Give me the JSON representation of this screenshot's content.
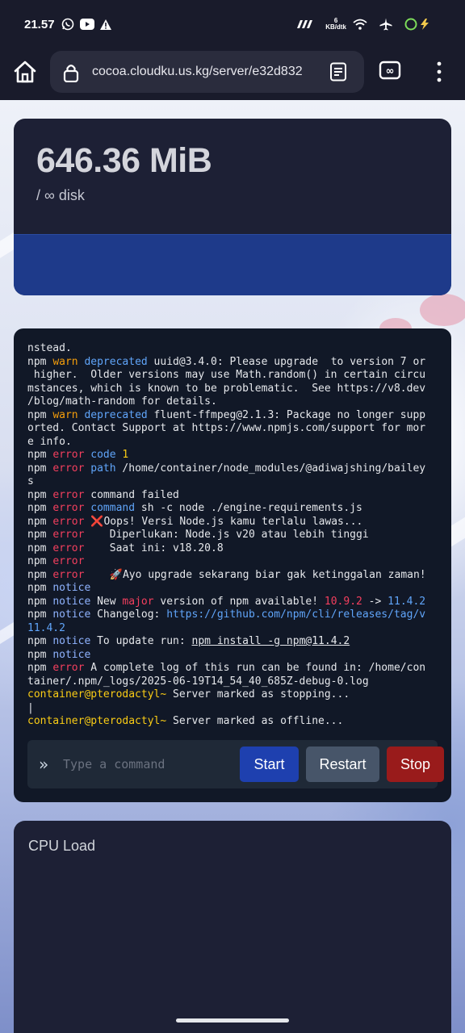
{
  "status_bar": {
    "time": "21.57",
    "net_speed_value": "6",
    "net_speed_unit": "KB/dtk",
    "icons": [
      "whatsapp-icon",
      "youtube-icon",
      "warning-icon",
      "signal-icon",
      "wifi-icon",
      "airplane-icon",
      "battery-icon"
    ]
  },
  "browser": {
    "url": "cocoa.cloudku.us.kg/server/e32d832",
    "icons": [
      "home-icon",
      "lock-icon",
      "reader-mode-icon",
      "tabs-icon",
      "more-vert-icon"
    ]
  },
  "disk": {
    "value": "646.36 MiB",
    "limit": "/ ∞ disk"
  },
  "console": {
    "lines": [
      [
        {
          "t": "nstead."
        }
      ],
      [
        {
          "t": "npm "
        },
        {
          "t": "warn",
          "c": "c-warn"
        },
        {
          "t": " "
        },
        {
          "t": "deprecated",
          "c": "c-blue"
        },
        {
          "t": " uuid@3.4.0: Please upgrade  to version 7 or"
        }
      ],
      [
        {
          "t": " higher.  Older versions may use Math.random() in certain circu"
        }
      ],
      [
        {
          "t": "mstances, which is known to be problematic.  See https://v8.dev"
        }
      ],
      [
        {
          "t": "/blog/math-random for details."
        }
      ],
      [
        {
          "t": "npm "
        },
        {
          "t": "warn",
          "c": "c-warn"
        },
        {
          "t": " "
        },
        {
          "t": "deprecated",
          "c": "c-blue"
        },
        {
          "t": " fluent-ffmpeg@2.1.3: Package no longer supp"
        }
      ],
      [
        {
          "t": "orted. Contact Support at https://www.npmjs.com/support for mor"
        }
      ],
      [
        {
          "t": "e info."
        }
      ],
      [
        {
          "t": "npm "
        },
        {
          "t": "error",
          "c": "c-err"
        },
        {
          "t": " "
        },
        {
          "t": "code",
          "c": "c-blue"
        },
        {
          "t": " "
        },
        {
          "t": "1",
          "c": "c-yellow"
        }
      ],
      [
        {
          "t": "npm "
        },
        {
          "t": "error",
          "c": "c-err"
        },
        {
          "t": " "
        },
        {
          "t": "path",
          "c": "c-blue"
        },
        {
          "t": " /home/container/node_modules/@adiwajshing/bailey"
        }
      ],
      [
        {
          "t": "s"
        }
      ],
      [
        {
          "t": "npm "
        },
        {
          "t": "error",
          "c": "c-err"
        },
        {
          "t": " command failed"
        }
      ],
      [
        {
          "t": "npm "
        },
        {
          "t": "error",
          "c": "c-err"
        },
        {
          "t": " "
        },
        {
          "t": "command",
          "c": "c-blue"
        },
        {
          "t": " sh -c node ./engine-requirements.js"
        }
      ],
      [
        {
          "t": "npm "
        },
        {
          "t": "error",
          "c": "c-err"
        },
        {
          "t": " "
        },
        {
          "t": "❌",
          "c": "c-err"
        },
        {
          "t": "Oops! Versi Node.js kamu terlalu lawas..."
        }
      ],
      [
        {
          "t": "npm "
        },
        {
          "t": "error",
          "c": "c-err"
        },
        {
          "t": "    Diperlukan: Node.js v20 atau lebih tinggi"
        }
      ],
      [
        {
          "t": "npm "
        },
        {
          "t": "error",
          "c": "c-err"
        },
        {
          "t": "    Saat ini: v18.20.8"
        }
      ],
      [
        {
          "t": "npm "
        },
        {
          "t": "error",
          "c": "c-err"
        }
      ],
      [
        {
          "t": "npm "
        },
        {
          "t": "error",
          "c": "c-err"
        },
        {
          "t": "    🚀Ayo upgrade sekarang biar gak ketinggalan zaman!"
        }
      ],
      [
        {
          "t": "npm "
        },
        {
          "t": "notice",
          "c": "c-notice"
        }
      ],
      [
        {
          "t": "npm "
        },
        {
          "t": "notice",
          "c": "c-notice"
        },
        {
          "t": " New "
        },
        {
          "t": "major",
          "c": "c-err"
        },
        {
          "t": " version of npm available! "
        },
        {
          "t": "10.9.2",
          "c": "c-err"
        },
        {
          "t": " -> "
        },
        {
          "t": "11.4.2",
          "c": "c-link"
        }
      ],
      [
        {
          "t": "npm "
        },
        {
          "t": "notice",
          "c": "c-notice"
        },
        {
          "t": " Changelog: "
        },
        {
          "t": "https://github.com/npm/cli/releases/tag/v",
          "c": "c-link"
        }
      ],
      [
        {
          "t": "11.4.2",
          "c": "c-link"
        }
      ],
      [
        {
          "t": "npm "
        },
        {
          "t": "notice",
          "c": "c-notice"
        },
        {
          "t": " To update run: "
        },
        {
          "t": "npm install -g npm@11.4.2",
          "c": "c-under"
        }
      ],
      [
        {
          "t": "npm "
        },
        {
          "t": "notice",
          "c": "c-notice"
        }
      ],
      [
        {
          "t": "npm "
        },
        {
          "t": "error",
          "c": "c-err"
        },
        {
          "t": " A complete log of this run can be found in: /home/con"
        }
      ],
      [
        {
          "t": "tainer/.npm/_logs/2025-06-19T14_54_40_685Z-debug-0.log"
        }
      ],
      [
        {
          "t": "container@pterodactyl~",
          "c": "c-yellow"
        },
        {
          "t": " Server marked as stopping..."
        }
      ],
      [
        {
          "t": "|"
        }
      ],
      [
        {
          "t": "container@pterodactyl~",
          "c": "c-yellow"
        },
        {
          "t": " Server marked as offline..."
        }
      ]
    ],
    "prompt_symbol": "»",
    "input_placeholder": "Type a command",
    "start_label": "Start",
    "restart_label": "Restart",
    "stop_label": "Stop"
  },
  "cpu": {
    "title": "CPU Load"
  },
  "colors": {
    "bar_bg": "#191b2b",
    "card_bg": "#1d2035",
    "console_bg": "#111827",
    "disk_bar": "#1e3a8a",
    "start": "#1e40af",
    "restart": "#475569",
    "stop": "#991b1b"
  }
}
